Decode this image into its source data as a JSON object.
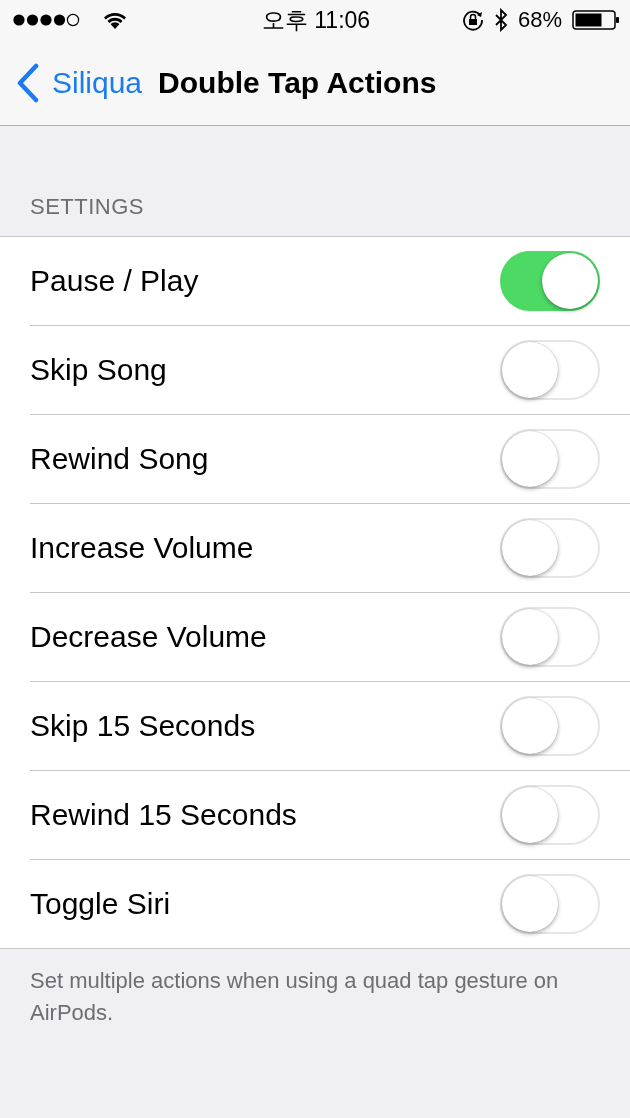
{
  "status_bar": {
    "time": "오후 11:06",
    "battery": "68%"
  },
  "nav": {
    "back": "Siliqua",
    "title": "Double Tap Actions"
  },
  "section": {
    "header": "SETTINGS",
    "rows": [
      {
        "label": "Pause / Play",
        "on": true
      },
      {
        "label": "Skip Song",
        "on": false
      },
      {
        "label": "Rewind Song",
        "on": false
      },
      {
        "label": "Increase Volume",
        "on": false
      },
      {
        "label": "Decrease Volume",
        "on": false
      },
      {
        "label": "Skip 15 Seconds",
        "on": false
      },
      {
        "label": "Rewind 15 Seconds",
        "on": false
      },
      {
        "label": "Toggle Siri",
        "on": false
      }
    ],
    "footer": "Set multiple actions when using a quad tap gesture on AirPods."
  }
}
